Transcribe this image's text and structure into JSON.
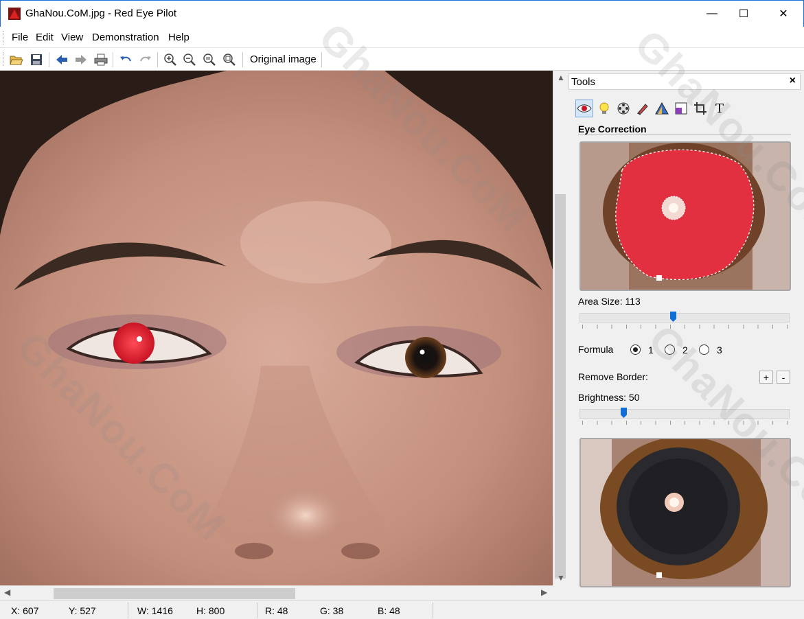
{
  "window": {
    "title": "GhaNou.CoM.jpg - Red Eye Pilot",
    "minimize_glyph": "—",
    "maximize_glyph": "☐",
    "close_glyph": "✕"
  },
  "menu": {
    "items": [
      "File",
      "Edit",
      "View",
      "Demonstration",
      "Help"
    ]
  },
  "toolbar": {
    "original_image_label": "Original image",
    "icons": [
      "open-folder-icon",
      "save-icon",
      "back-arrow-icon",
      "forward-arrow-icon",
      "print-icon",
      "undo-icon",
      "redo-icon",
      "zoom-in-icon",
      "zoom-out-icon",
      "zoom-fit-icon",
      "zoom-actual-icon"
    ]
  },
  "tools_panel": {
    "title": "Tools",
    "close_glyph": "×",
    "tool_icons": [
      "eye-icon",
      "bulb-icon",
      "film-reel-icon",
      "brush-icon",
      "triangle-icon",
      "resize-icon",
      "crop-icon",
      "text-icon"
    ],
    "text_tool_glyph": "T",
    "section_title": "Eye Correction",
    "area_size_label": "Area Size: 113",
    "area_size_value": 113,
    "area_size_fraction": 0.44,
    "formula_label": "Formula",
    "formula_options": [
      "1",
      "2",
      "3"
    ],
    "formula_selected": "1",
    "remove_border_label": "Remove Border:",
    "plus_label": "+",
    "minus_label": "-",
    "brightness_label": "Brightness: 50",
    "brightness_value": 50,
    "brightness_fraction": 0.2
  },
  "status": {
    "x": "X: 607",
    "y": "Y: 527",
    "w": "W: 1416",
    "h": "H: 800",
    "r": "R: 48",
    "g": "G: 38",
    "b": "B: 48"
  },
  "watermark": "GhaNou.CoM",
  "colors": {
    "red_eye": "#e8283a",
    "skin": "#c99a88",
    "accent": "#0f6fd6"
  }
}
